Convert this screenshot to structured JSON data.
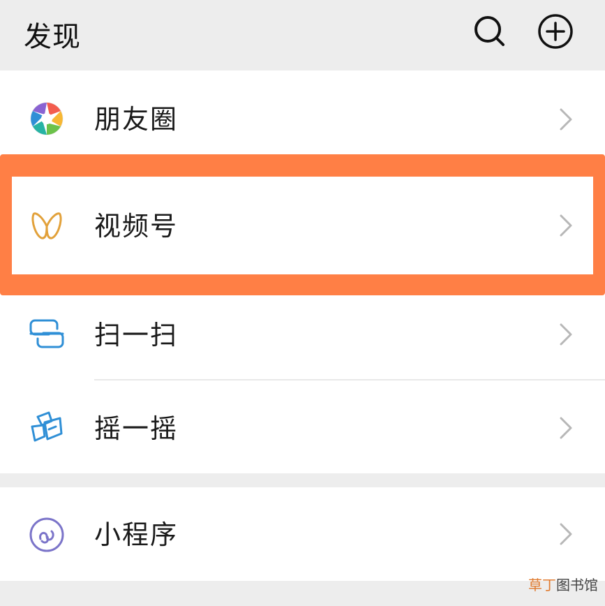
{
  "header": {
    "title": "发现",
    "search_icon": "search-icon",
    "add_icon": "plus-circle-icon"
  },
  "items": [
    {
      "label": "朋友圈",
      "icon": "moments-aperture-icon",
      "chevron": "chevron-right-icon"
    },
    {
      "label": "视频号",
      "icon": "channels-butterfly-icon",
      "chevron": "chevron-right-icon",
      "highlighted": true,
      "highlight_color": "#ff7f45"
    },
    {
      "label": "扫一扫",
      "icon": "scan-icon",
      "chevron": "chevron-right-icon"
    },
    {
      "label": "摇一摇",
      "icon": "shake-icon",
      "chevron": "chevron-right-icon"
    },
    {
      "label": "小程序",
      "icon": "mini-program-icon",
      "chevron": "chevron-right-icon"
    }
  ],
  "watermark": {
    "accent": "草丁",
    "rest": "图书馆"
  },
  "colors": {
    "background": "#ededed",
    "card": "#ffffff",
    "highlight": "#ff7f45",
    "channels_icon": "#e2a13a",
    "scan_icon": "#2f8fd6",
    "mini_program_icon": "#7b74c9"
  }
}
